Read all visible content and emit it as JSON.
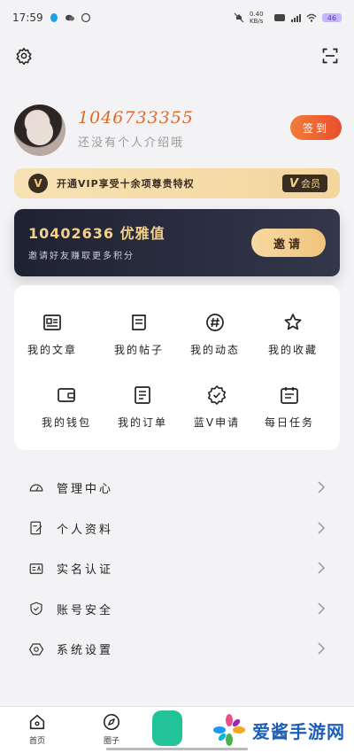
{
  "status": {
    "time": "17:59",
    "net_speed": "0.40 KB/s",
    "battery": "46"
  },
  "profile": {
    "uid": "1046733355",
    "bio": "还没有个人介绍哦",
    "signin_label": "签到"
  },
  "vip": {
    "promo": "开通VIP享受十余项尊贵特权",
    "badge": "V",
    "member_label": "会员"
  },
  "elegant": {
    "value": "10402636 优雅值",
    "subtitle": "邀请好友赚取更多积分",
    "invite_label": "邀请"
  },
  "grid": [
    {
      "label": "我的文章",
      "icon": "article-icon"
    },
    {
      "label": "我的帖子",
      "icon": "post-icon"
    },
    {
      "label": "我的动态",
      "icon": "hashtag-icon"
    },
    {
      "label": "我的收藏",
      "icon": "star-icon"
    },
    {
      "label": "我的钱包",
      "icon": "wallet-icon"
    },
    {
      "label": "我的订单",
      "icon": "order-icon"
    },
    {
      "label": "蓝V申请",
      "icon": "verified-badge-icon"
    },
    {
      "label": "每日任务",
      "icon": "calendar-icon"
    }
  ],
  "menu": [
    {
      "label": "管理中心",
      "icon": "dashboard-icon"
    },
    {
      "label": "个人资料",
      "icon": "edit-profile-icon"
    },
    {
      "label": "实名认证",
      "icon": "id-card-icon"
    },
    {
      "label": "账号安全",
      "icon": "shield-icon"
    },
    {
      "label": "系统设置",
      "icon": "settings-hex-icon"
    }
  ],
  "tabs": [
    {
      "label": "首页",
      "icon": "home-icon"
    },
    {
      "label": "圈子",
      "icon": "compass-icon"
    }
  ],
  "watermark": {
    "text": "爱酱手游网"
  }
}
